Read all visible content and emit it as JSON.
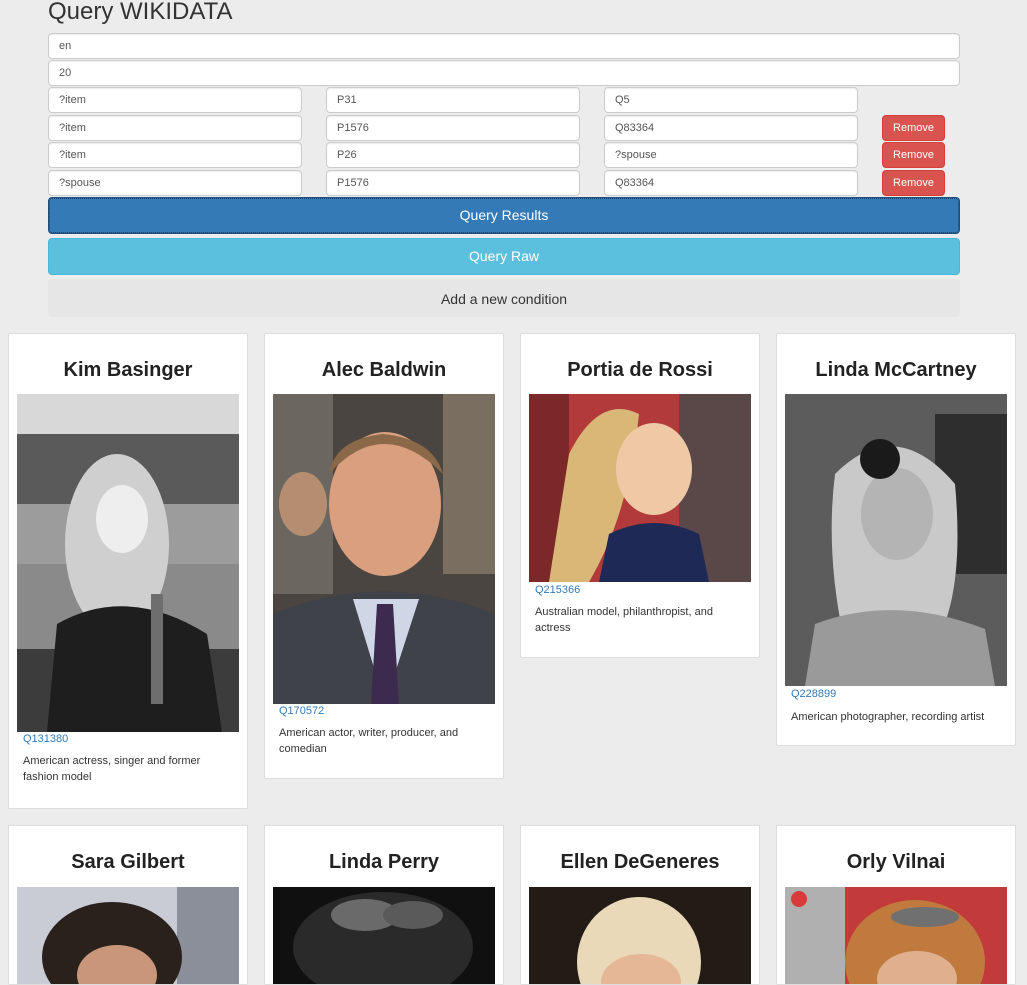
{
  "page": {
    "title": "Query WIKIDATA"
  },
  "settings": {
    "language": "en",
    "limit": "20"
  },
  "conditions": [
    {
      "subject": "?item",
      "property": "P31",
      "object": "Q5",
      "remove_label": ""
    },
    {
      "subject": "?item",
      "property": "P1576",
      "object": "Q83364",
      "remove_label": "Remove"
    },
    {
      "subject": "?item",
      "property": "P26",
      "object": "?spouse",
      "remove_label": "Remove"
    },
    {
      "subject": "?spouse",
      "property": "P1576",
      "object": "Q83364",
      "remove_label": "Remove"
    }
  ],
  "buttons": {
    "query_results": "Query Results",
    "query_raw": "Query Raw",
    "add_condition": "Add a new condition"
  },
  "colors": {
    "primary": "#337ab7",
    "info": "#5bc0de",
    "danger": "#d9534f",
    "link": "#337ab7"
  },
  "results": [
    {
      "name": "Kim Basinger",
      "qid": "Q131380",
      "description": "American actress, singer and former fashion model",
      "photo": "black-and-white-photo"
    },
    {
      "name": "Alec Baldwin",
      "qid": "Q170572",
      "description": "American actor, writer, producer, and comedian",
      "photo": "color-photo"
    },
    {
      "name": "Portia de Rossi",
      "qid": "Q215366",
      "description": "Australian model, philanthropist, and actress",
      "photo": "color-photo"
    },
    {
      "name": "Linda McCartney",
      "qid": "Q228899",
      "description": "American photographer, recording artist",
      "photo": "black-and-white-photo"
    },
    {
      "name": "Sara Gilbert",
      "qid": "",
      "description": "",
      "photo": "color-photo"
    },
    {
      "name": "Linda Perry",
      "qid": "",
      "description": "",
      "photo": "color-photo"
    },
    {
      "name": "Ellen DeGeneres",
      "qid": "",
      "description": "",
      "photo": "color-photo"
    },
    {
      "name": "Orly Vilnai",
      "qid": "",
      "description": "",
      "photo": "color-photo"
    }
  ]
}
